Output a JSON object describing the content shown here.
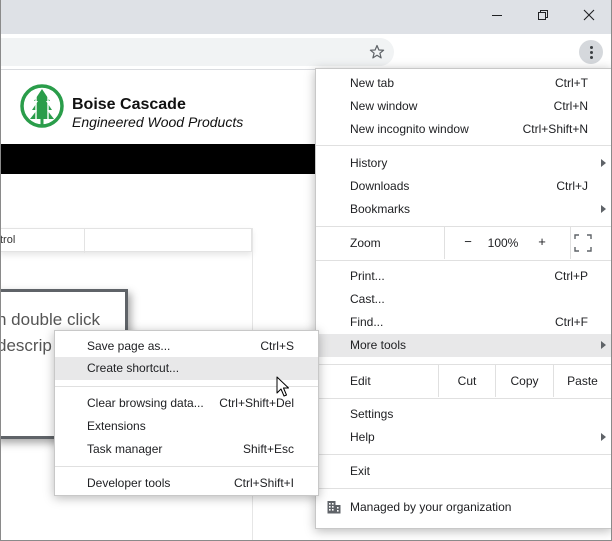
{
  "window": {
    "minimize_icon": "minimize-icon",
    "restore_icon": "restore-icon",
    "close_icon": "close-icon"
  },
  "toolbar": {
    "bookmark_icon": "star-icon",
    "menu_icon": "three-dots-vertical-icon"
  },
  "page": {
    "brand_name": "Boise Cascade",
    "brand_tagline": "Engineered Wood Products",
    "table_header_fragment": "trol",
    "dialog_line1": "n double click",
    "dialog_line2": "descrip"
  },
  "menu": {
    "new_tab": {
      "label": "New tab",
      "shortcut": "Ctrl+T"
    },
    "new_window": {
      "label": "New window",
      "shortcut": "Ctrl+N"
    },
    "new_incognito": {
      "label": "New incognito window",
      "shortcut": "Ctrl+Shift+N"
    },
    "history": {
      "label": "History"
    },
    "downloads": {
      "label": "Downloads",
      "shortcut": "Ctrl+J"
    },
    "bookmarks": {
      "label": "Bookmarks"
    },
    "zoom": {
      "label": "Zoom",
      "minus": "−",
      "value": "100%",
      "plus": "+"
    },
    "print": {
      "label": "Print...",
      "shortcut": "Ctrl+P"
    },
    "cast": {
      "label": "Cast..."
    },
    "find": {
      "label": "Find...",
      "shortcut": "Ctrl+F"
    },
    "more_tools": {
      "label": "More tools"
    },
    "edit": {
      "label": "Edit",
      "cut": "Cut",
      "copy": "Copy",
      "paste": "Paste"
    },
    "settings": {
      "label": "Settings"
    },
    "help": {
      "label": "Help"
    },
    "exit": {
      "label": "Exit"
    },
    "managed": {
      "label": "Managed by your organization",
      "icon": "building-icon"
    }
  },
  "submenu": {
    "save_page": {
      "label": "Save page as...",
      "shortcut": "Ctrl+S"
    },
    "create_shortcut": {
      "label": "Create shortcut..."
    },
    "clear_browsing": {
      "label": "Clear browsing data...",
      "shortcut": "Ctrl+Shift+Del"
    },
    "extensions": {
      "label": "Extensions"
    },
    "task_manager": {
      "label": "Task manager",
      "shortcut": "Shift+Esc"
    },
    "developer_tools": {
      "label": "Developer tools",
      "shortcut": "Ctrl+Shift+I"
    }
  },
  "colors": {
    "titlebar": "#dee1e6",
    "menu_hover": "#e8e8e9",
    "logo_green": "#2a9d4a"
  }
}
